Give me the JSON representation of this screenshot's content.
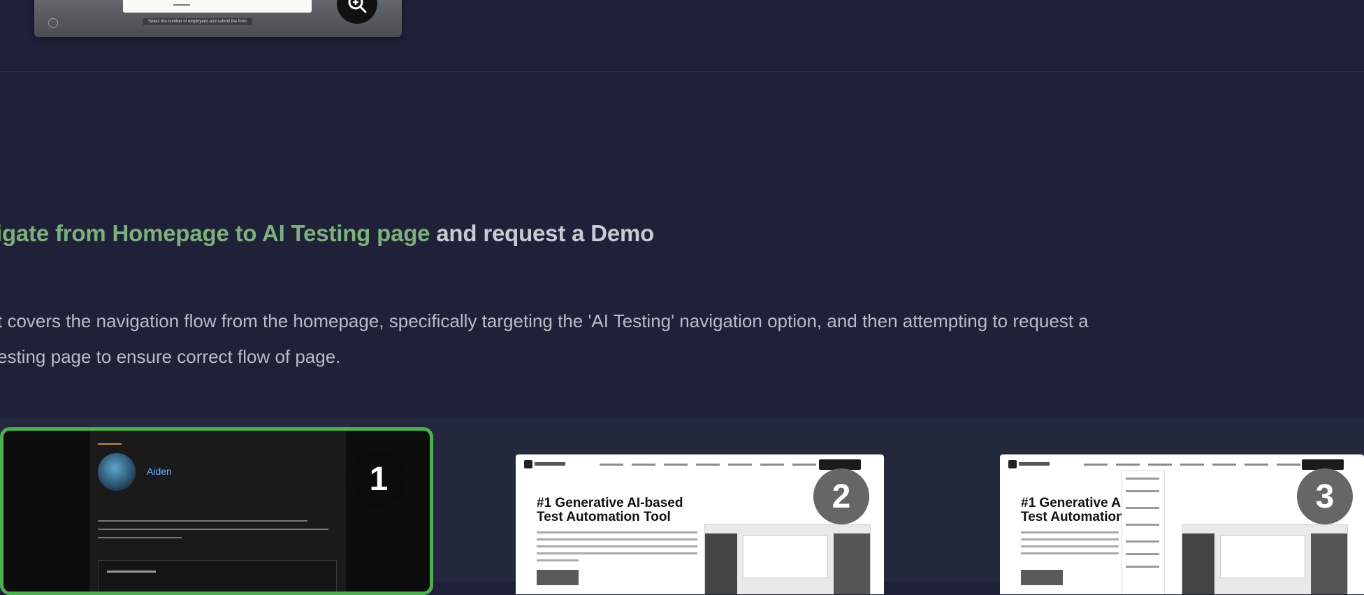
{
  "top_card": {
    "caption": "Select the number of employees and submit the form",
    "zoom_icon": "zoom-in-icon"
  },
  "test": {
    "title_highlight": "igate from Homepage to AI Testing page",
    "title_rest": " and request a Demo",
    "description_line1": "t covers the navigation flow from the homepage, specifically targeting the 'AI Testing' navigation option, and then attempting to request a",
    "description_line2": "esting page to ensure correct flow of page."
  },
  "screenshots": [
    {
      "step": "1",
      "user_name": "Aiden",
      "avatar_icon": "user-avatar"
    },
    {
      "step": "2",
      "hero_line1": "#1 Generative AI-based",
      "hero_line2": "Test Automation Tool"
    },
    {
      "step": "3",
      "hero_line1": "#1 Generative A",
      "hero_line2": "Test Automation"
    }
  ],
  "colors": {
    "background": "#1e2137",
    "highlight": "#7db07c",
    "active_border": "#4caf50"
  }
}
